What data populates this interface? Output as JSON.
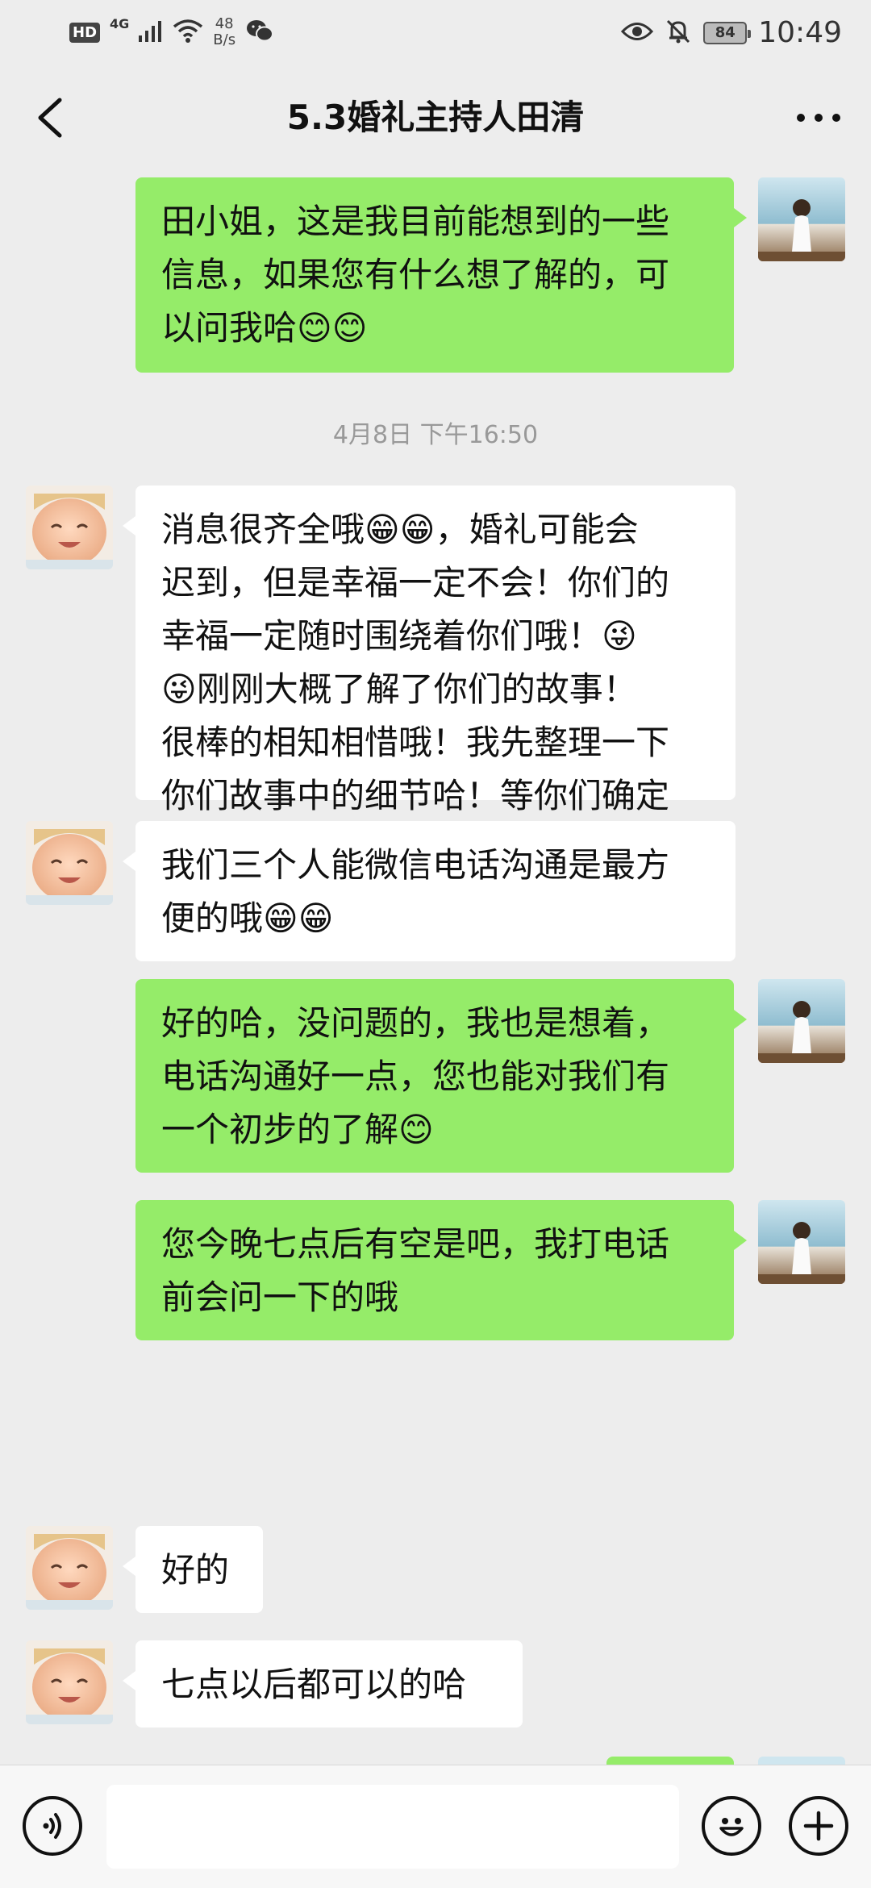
{
  "status_bar": {
    "hd": "HD",
    "network": "4G",
    "rate_value": "48",
    "rate_unit": "B/s",
    "battery": "84",
    "time": "10:49",
    "icons": [
      "signal-icon",
      "wifi-icon",
      "wechat-icon",
      "eye-icon",
      "mute-bell-icon"
    ]
  },
  "header": {
    "title": "5.3婚礼主持人田清",
    "back_icon": "chevron-left-icon",
    "more_icon": "more-dots-icon"
  },
  "messages": [
    {
      "side": "sent",
      "text": "田小姐，这是我目前能想到的一些\n信息，如果您有什么想了解的，可\n以问我哈😊😊"
    },
    {
      "type": "time",
      "text": "4月8日 下午16:50"
    },
    {
      "side": "received",
      "text": "消息很齐全哦😁😁，婚礼可能会\n迟到，但是幸福一定不会！你们的\n幸福一定随时围绕着你们哦！😜\n😜刚刚大概了解了你们的故事！\n很棒的相知相惜哦！我先整理一下\n你们故事中的细节哈！等你们确定\n好了可以通话的时间后，告诉我一\n声就行哈"
    },
    {
      "side": "received",
      "text": "我们三个人能微信电话沟通是最方\n便的哦😁😁"
    },
    {
      "side": "sent",
      "text": "好的哈，没问题的，我也是想着，\n电话沟通好一点，您也能对我们有\n一个初步的了解😊"
    },
    {
      "side": "sent",
      "text": "您今晚七点后有空是吧，我打电话\n前会问一下的哦"
    },
    {
      "side": "received",
      "text": "好的"
    },
    {
      "side": "received",
      "text": "七点以后都可以的哈"
    }
  ],
  "input_bar": {
    "voice_icon": "voice-icon",
    "emoji_icon": "emoji-icon",
    "add_icon": "plus-icon",
    "text_value": ""
  },
  "colors": {
    "background": "#ededed",
    "sent_bubble": "#95ec69",
    "received_bubble": "#ffffff"
  }
}
